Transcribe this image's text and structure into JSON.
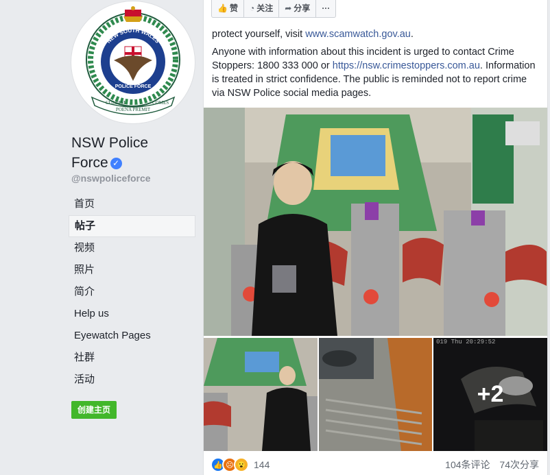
{
  "sidebar": {
    "page_name": "NSW Police Force",
    "handle": "@nswpoliceforce",
    "logo_texts": {
      "top_arc": "NEW SOUTH WALES",
      "band": "POLICE FORCE",
      "motto_left": "CULPAM",
      "motto_center": "POENA PREMIT",
      "motto_right": "COMES"
    },
    "nav": [
      {
        "label": "首页",
        "active": false
      },
      {
        "label": "帖子",
        "active": true
      },
      {
        "label": "视频",
        "active": false
      },
      {
        "label": "照片",
        "active": false
      },
      {
        "label": "简介",
        "active": false
      },
      {
        "label": "Help us",
        "active": false
      },
      {
        "label": "Eyewatch Pages",
        "active": false
      },
      {
        "label": "社群",
        "active": false
      },
      {
        "label": "活动",
        "active": false
      }
    ],
    "create_page_label": "创建主页"
  },
  "toolbar": {
    "like_label": "赞",
    "follow_label": "关注",
    "share_label": "分享",
    "more_label": "···"
  },
  "post": {
    "line1_prefix": "protect yourself, visit ",
    "line1_link": "www.scamwatch.gov.au",
    "line1_suffix": ".",
    "para2_part1": "Anyone with information about this incident is urged to contact Crime Stoppers: 1800 333 000 or ",
    "para2_link": "https://nsw.crimestoppers.com.au",
    "para2_part2": ". Information is treated in strict confidence. The public is reminded not to report crime via NSW Police social media pages.",
    "more_photos": "+2",
    "thumb_timestamp": "019 Thu 20:29:52",
    "reaction_count": "144",
    "comments": "104条评论",
    "shares": "74次分享"
  },
  "colors": {
    "link": "#385898",
    "create_button": "#42b72a",
    "verified": "#4080ff"
  }
}
